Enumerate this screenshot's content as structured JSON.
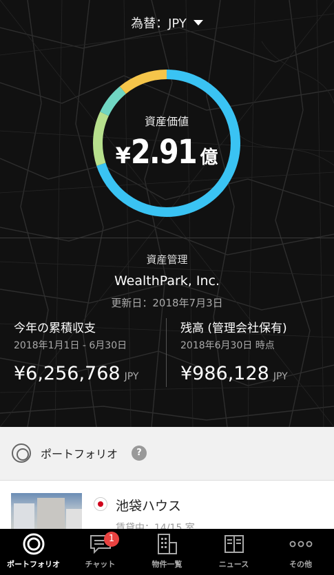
{
  "header": {
    "currency_label": "為替：JPY"
  },
  "asset_value": {
    "label": "資産価値",
    "yen": "¥",
    "amount": "2.91",
    "unit": "億",
    "segments": [
      {
        "name": "blue",
        "color": "#3ac3f3",
        "fraction": 0.7
      },
      {
        "name": "green",
        "color": "#b7e08d",
        "fraction": 0.12
      },
      {
        "name": "teal",
        "color": "#70d6c2",
        "fraction": 0.07
      },
      {
        "name": "yellow",
        "color": "#f5c54a",
        "fraction": 0.11
      }
    ]
  },
  "management": {
    "label": "資産管理",
    "company": "WealthPark, Inc.",
    "updated": "更新日：2018年7月3日"
  },
  "stats": {
    "left": {
      "title": "今年の累積収支",
      "period": "2018年1月1日 - 6月30日",
      "amount": "¥6,256,768",
      "currency": "JPY"
    },
    "right": {
      "title": "残高 (管理会社保有)",
      "period": "2018年6月30日 時点",
      "amount": "¥986,128",
      "currency": "JPY"
    }
  },
  "portfolio": {
    "title": "ポートフォリオ",
    "help": "?",
    "property": {
      "name": "池袋ハウス",
      "status": "賃貸中：14/15 室"
    }
  },
  "tabbar": {
    "tabs": [
      {
        "label": "ポートフォリオ",
        "icon": "portfolio-icon",
        "active": true
      },
      {
        "label": "チャット",
        "icon": "chat-icon",
        "badge": "1"
      },
      {
        "label": "物件一覧",
        "icon": "building-icon"
      },
      {
        "label": "ニュース",
        "icon": "news-icon"
      },
      {
        "label": "その他",
        "icon": "more-icon"
      }
    ]
  }
}
